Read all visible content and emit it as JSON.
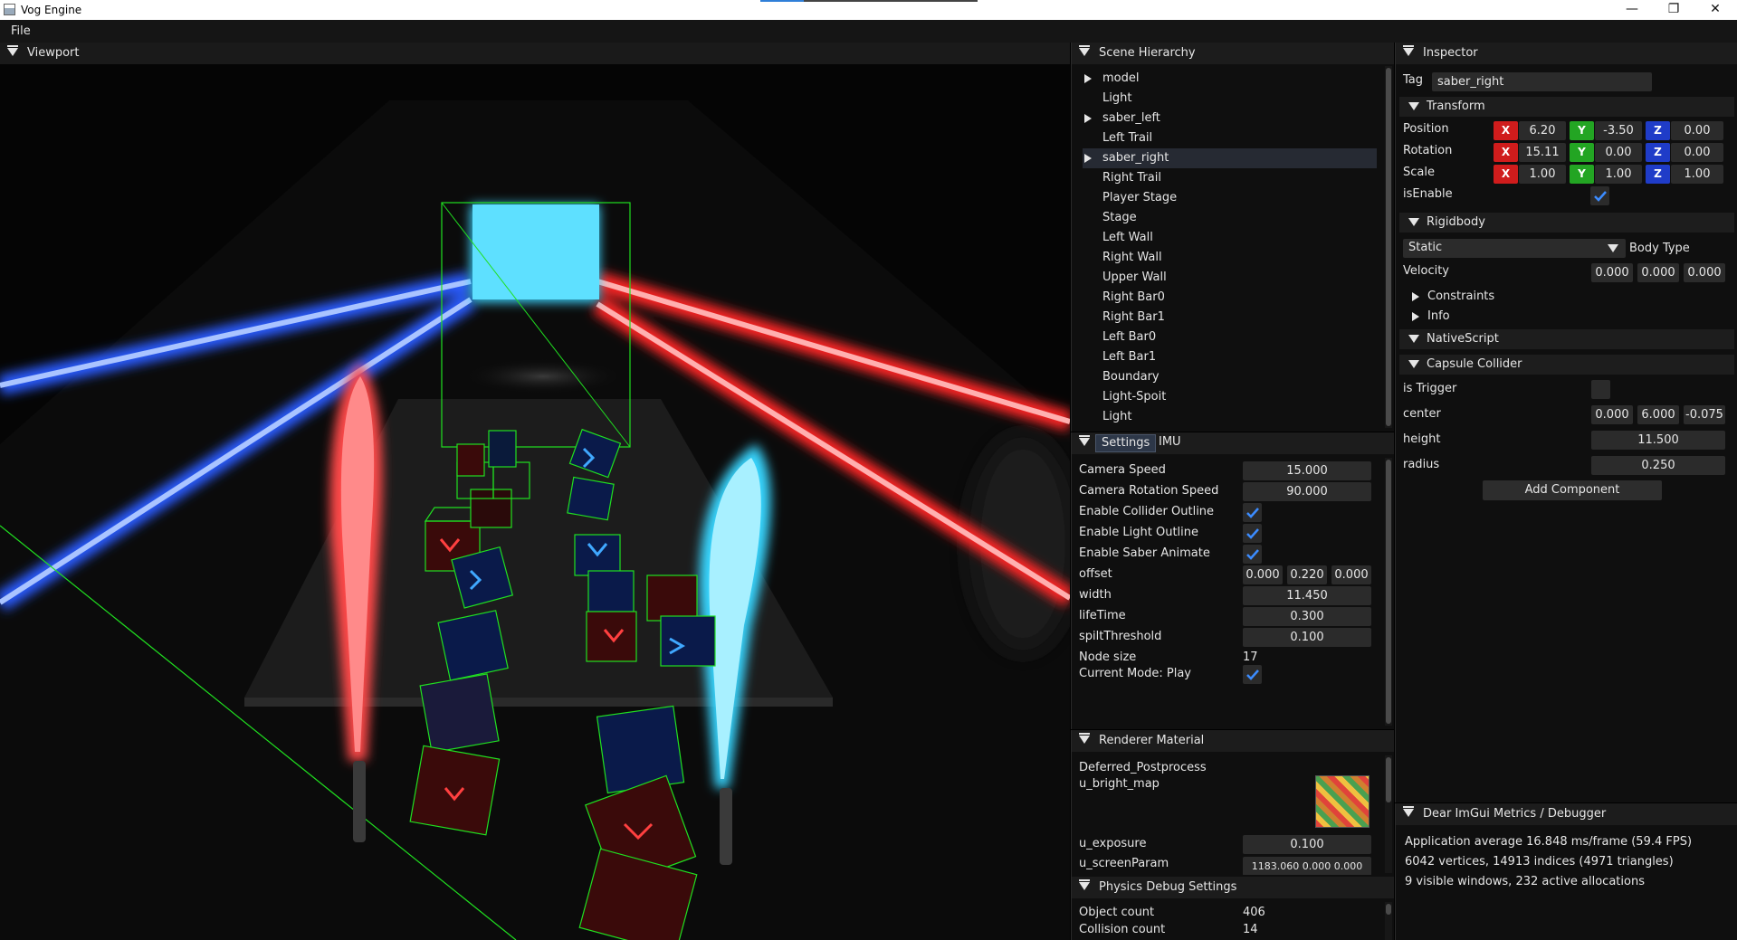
{
  "window": {
    "title": "Vog Engine",
    "minimize": "—",
    "maximize": "❐",
    "close": "✕"
  },
  "menu": {
    "file": "File"
  },
  "viewport": {
    "title": "Viewport"
  },
  "hierarchy": {
    "title": "Scene Hierarchy",
    "items": [
      {
        "label": "model",
        "expandable": true
      },
      {
        "label": "Light",
        "expandable": false
      },
      {
        "label": "saber_left",
        "expandable": true
      },
      {
        "label": "Left Trail",
        "expandable": false
      },
      {
        "label": "saber_right",
        "expandable": true,
        "selected": true
      },
      {
        "label": "Right Trail",
        "expandable": false
      },
      {
        "label": "Player Stage",
        "expandable": false
      },
      {
        "label": "Stage",
        "expandable": false
      },
      {
        "label": "Left Wall",
        "expandable": false
      },
      {
        "label": "Right Wall",
        "expandable": false
      },
      {
        "label": "Upper Wall",
        "expandable": false
      },
      {
        "label": "Right Bar0",
        "expandable": false
      },
      {
        "label": "Right Bar1",
        "expandable": false
      },
      {
        "label": "Left Bar0",
        "expandable": false
      },
      {
        "label": "Left Bar1",
        "expandable": false
      },
      {
        "label": "Boundary",
        "expandable": false
      },
      {
        "label": "Light-Spoit",
        "expandable": false
      },
      {
        "label": "Light",
        "expandable": false
      }
    ]
  },
  "settings": {
    "tab_settings": "Settings",
    "tab_imu": "IMU",
    "camera_speed_label": "Camera Speed",
    "camera_speed": "15.000",
    "camera_rot_label": "Camera Rotation Speed",
    "camera_rot": "90.000",
    "collider_outline_label": "Enable Collider Outline",
    "light_outline_label": "Enable Light Outline",
    "saber_animate_label": "Enable Saber Animate",
    "offset_label": "offset",
    "offset": [
      "0.000",
      "0.220",
      "0.000"
    ],
    "width_label": "width",
    "width": "11.450",
    "lifetime_label": "lifeTime",
    "lifetime": "0.300",
    "split_label": "spiltThreshold",
    "split": "0.100",
    "node_size_label": "Node size",
    "node_size": "17",
    "mode_label": "Current Mode: Play"
  },
  "material": {
    "title": "Renderer Material",
    "shader": "Deferred_Postprocess",
    "bright_map_label": "u_bright_map",
    "exposure_label": "u_exposure",
    "exposure": "0.100",
    "screen_param_label": "u_screenParam",
    "screen_param": "1183.060 0.000 0.000"
  },
  "physics": {
    "title": "Physics Debug Settings",
    "object_count_label": "Object count",
    "object_count": "406",
    "collision_count_label": "Collision count",
    "collision_count": "14"
  },
  "inspector": {
    "title": "Inspector",
    "tag_label": "Tag",
    "tag": "saber_right",
    "transform": "Transform",
    "position_label": "Position",
    "position": [
      "6.20",
      "-3.50",
      "0.00"
    ],
    "rotation_label": "Rotation",
    "rotation": [
      "15.11",
      "0.00",
      "0.00"
    ],
    "scale_label": "Scale",
    "scale": [
      "1.00",
      "1.00",
      "1.00"
    ],
    "axis_x": "X",
    "axis_y": "Y",
    "axis_z": "Z",
    "is_enable_label": "isEnable",
    "rigidbody": "Rigidbody",
    "body_type_value": "Static",
    "body_type_label": "Body Type",
    "velocity_label": "Velocity",
    "velocity": [
      "0.000",
      "0.000",
      "0.000"
    ],
    "constraints": "Constraints",
    "info": "Info",
    "native_script": "NativeScript",
    "capsule_collider": "Capsule Collider",
    "is_trigger_label": "is Trigger",
    "center_label": "center",
    "center": [
      "0.000",
      "6.000",
      "-0.075"
    ],
    "height_label": "height",
    "height": "11.500",
    "radius_label": "radius",
    "radius": "0.250",
    "add_component": "Add Component"
  },
  "metrics": {
    "title": "Dear ImGui Metrics / Debugger",
    "line1": "Application average 16.848 ms/frame (59.4 FPS)",
    "line2": "6042 vertices, 14913 indices (4971 triangles)",
    "line3": "9 visible windows, 232 active allocations"
  },
  "colors": {
    "accent_blue": "#2f6fd6",
    "axis_x": "#d01c1c",
    "axis_y": "#23a523",
    "axis_z": "#1f3cc8",
    "saber_red": "#ff3b3b",
    "saber_blue": "#3cd6ff"
  }
}
